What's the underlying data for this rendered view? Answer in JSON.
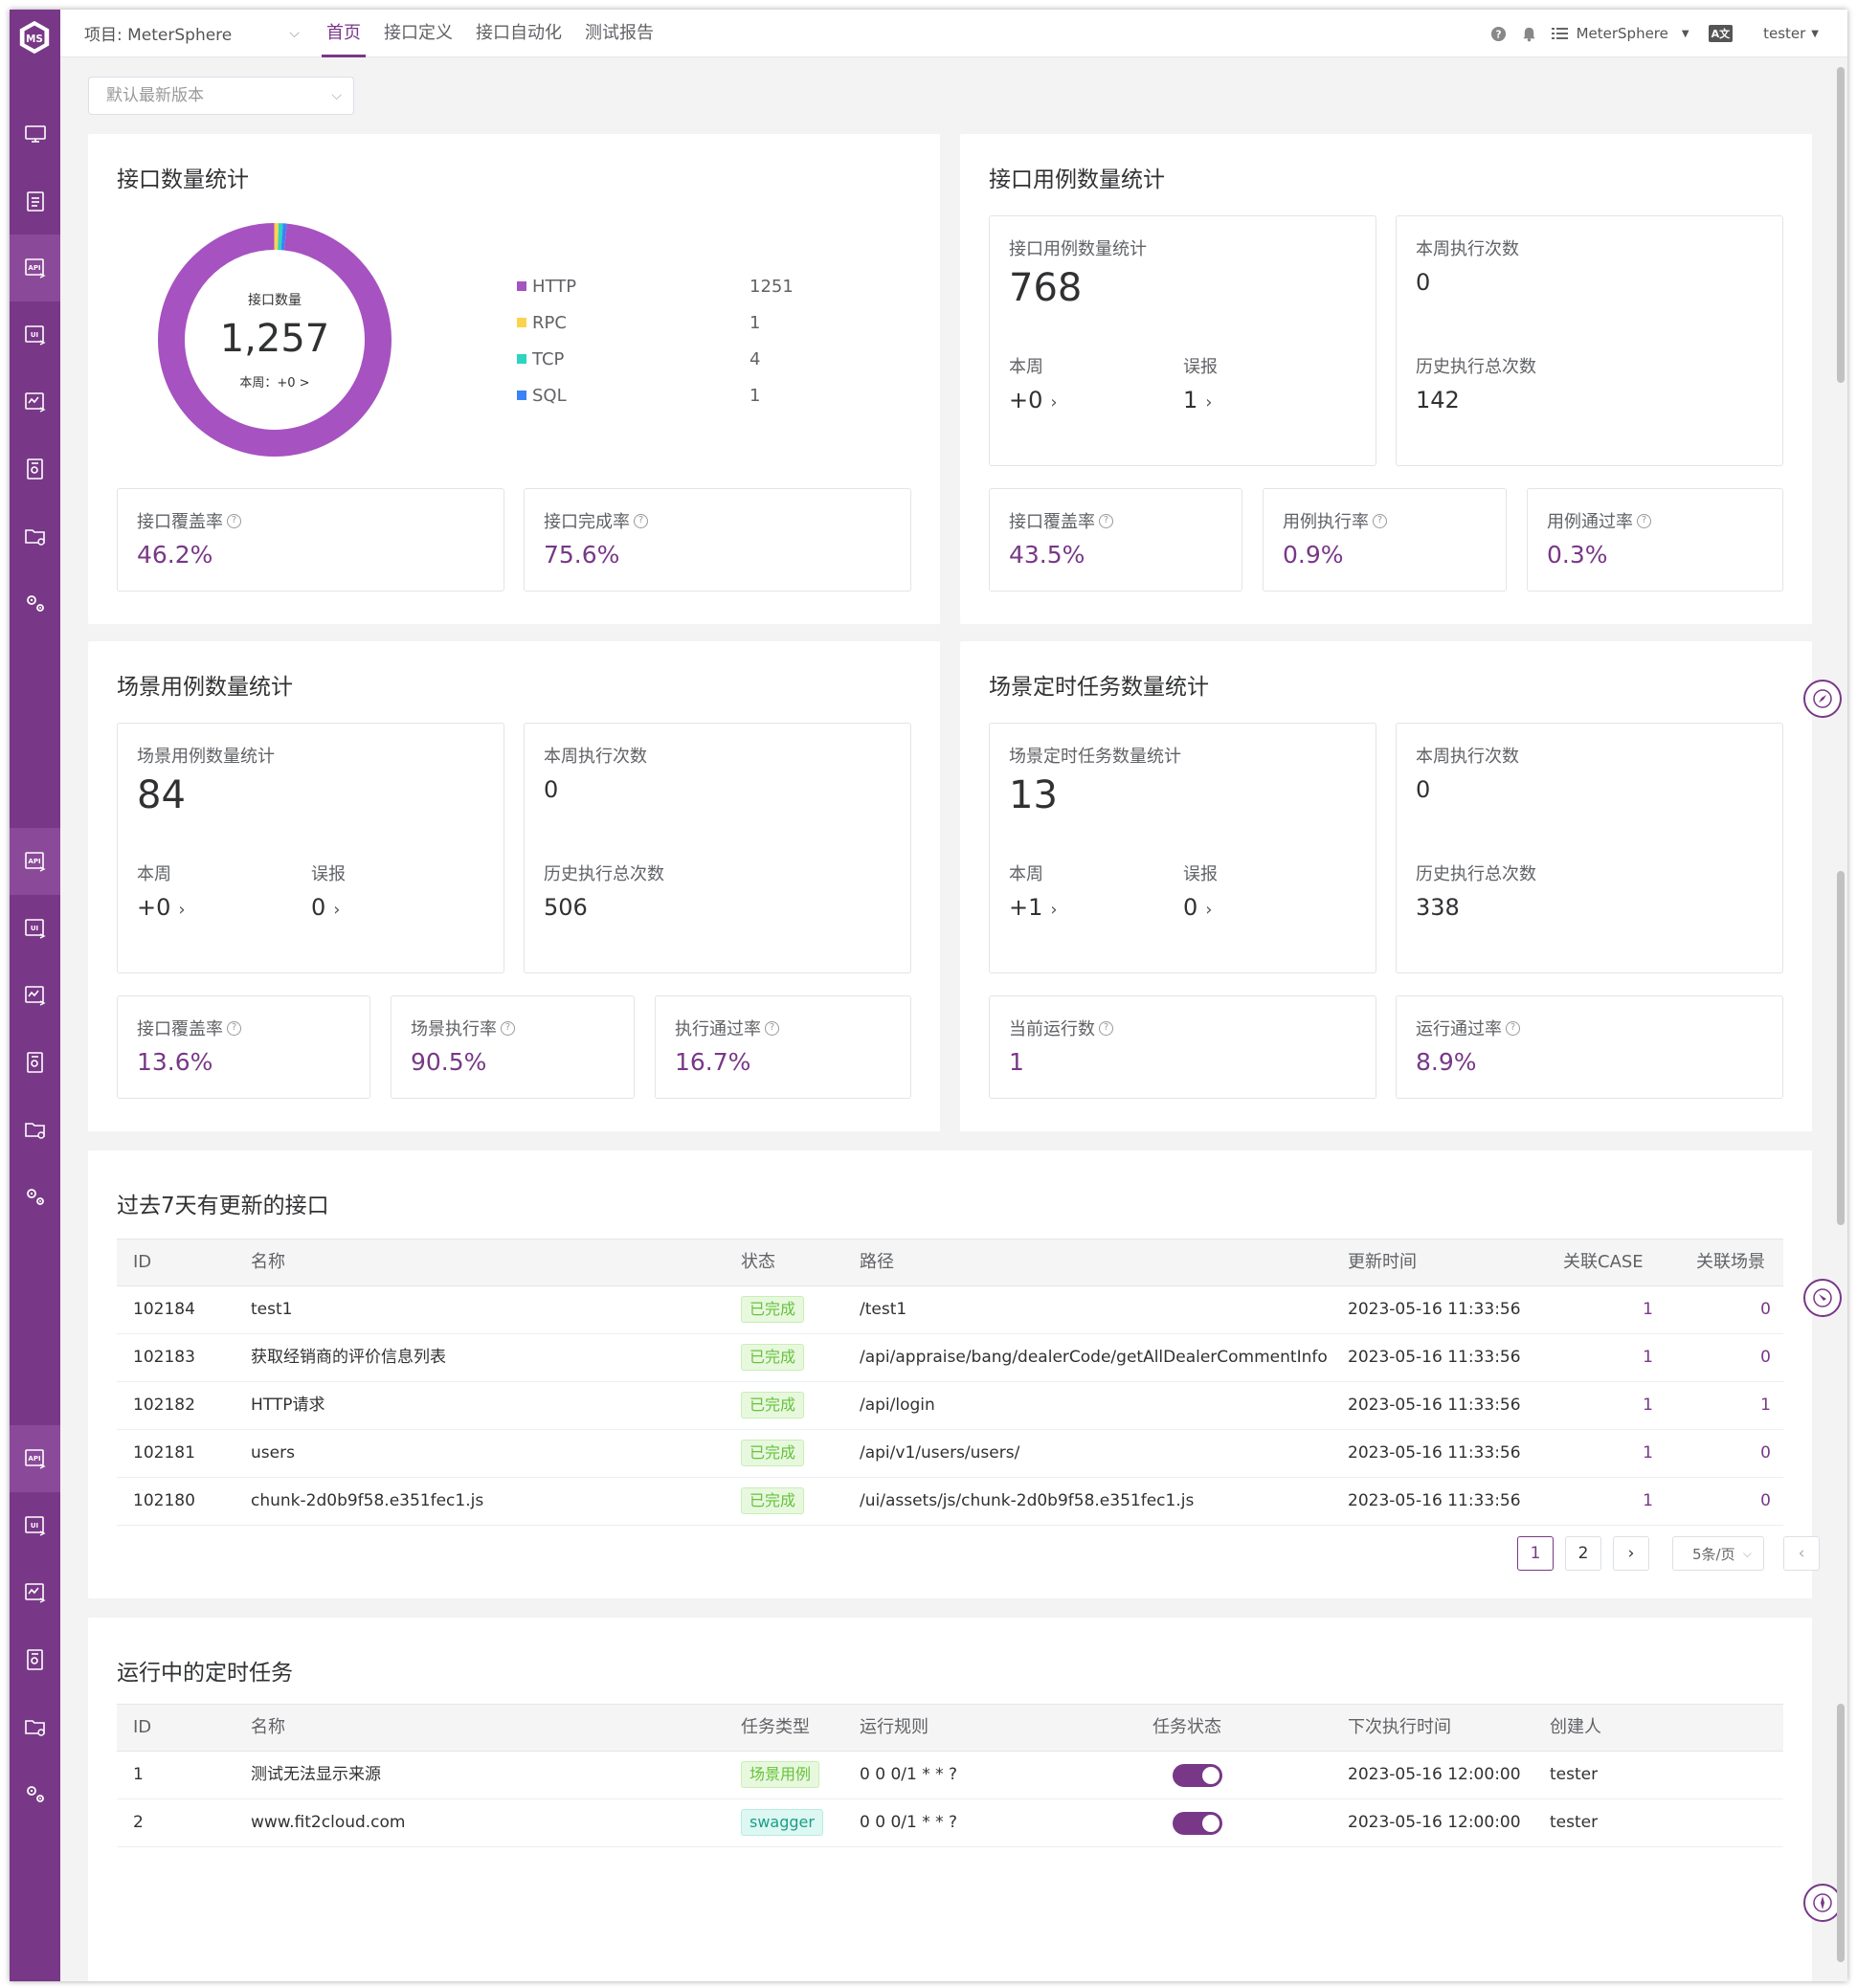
{
  "header": {
    "project_label": "项目: MeterSphere",
    "nav": [
      "首页",
      "接口定义",
      "接口自动化",
      "测试报告"
    ],
    "workspace": "MeterSphere",
    "lang_icon": "A文",
    "user": "tester"
  },
  "version_select": "默认最新版本",
  "api_count": {
    "title": "接口数量统计",
    "donut_label": "接口数量",
    "total": "1,257",
    "week": "本周：+0 >",
    "legend": [
      {
        "name": "HTTP",
        "value": "1251",
        "color": "#a652c1"
      },
      {
        "name": "RPC",
        "value": "1",
        "color": "#fcd34d"
      },
      {
        "name": "TCP",
        "value": "4",
        "color": "#2dd4bf"
      },
      {
        "name": "SQL",
        "value": "1",
        "color": "#3b82f6"
      }
    ],
    "chart_data": {
      "type": "pie",
      "categories": [
        "HTTP",
        "RPC",
        "TCP",
        "SQL"
      ],
      "values": [
        1251,
        1,
        4,
        1
      ]
    },
    "coverage_label": "接口覆盖率",
    "coverage": "46.2%",
    "completion_label": "接口完成率",
    "completion": "75.6%"
  },
  "case_count": {
    "title": "接口用例数量统计",
    "stat_label": "接口用例数量统计",
    "total": "768",
    "week_label": "本周",
    "week": "+0",
    "false_label": "误报",
    "false": "1",
    "exec_week_label": "本周执行次数",
    "exec_week": "0",
    "exec_total_label": "历史执行总次数",
    "exec_total": "142",
    "coverage_label": "接口覆盖率",
    "coverage": "43.5%",
    "exec_rate_label": "用例执行率",
    "exec_rate": "0.9%",
    "pass_rate_label": "用例通过率",
    "pass_rate": "0.3%"
  },
  "scenario_count": {
    "title": "场景用例数量统计",
    "stat_label": "场景用例数量统计",
    "total": "84",
    "week_label": "本周",
    "week": "+0",
    "false_label": "误报",
    "false": "0",
    "exec_week_label": "本周执行次数",
    "exec_week": "0",
    "exec_total_label": "历史执行总次数",
    "exec_total": "506",
    "coverage_label": "接口覆盖率",
    "coverage": "13.6%",
    "exec_rate_label": "场景执行率",
    "exec_rate": "90.5%",
    "pass_rate_label": "执行通过率",
    "pass_rate": "16.7%"
  },
  "schedule_count": {
    "title": "场景定时任务数量统计",
    "stat_label": "场景定时任务数量统计",
    "total": "13",
    "week_label": "本周",
    "week": "+1",
    "false_label": "误报",
    "false": "0",
    "exec_week_label": "本周执行次数",
    "exec_week": "0",
    "exec_total_label": "历史执行总次数",
    "exec_total": "338",
    "running_label": "当前运行数",
    "running": "1",
    "pass_rate_label": "运行通过率",
    "pass_rate": "8.9%"
  },
  "updated_apis": {
    "title": "过去7天有更新的接口",
    "columns": [
      "ID",
      "名称",
      "状态",
      "路径",
      "更新时间",
      "关联CASE",
      "关联场景"
    ],
    "rows": [
      {
        "id": "102184",
        "name": "test1",
        "status": "已完成",
        "path": "/test1",
        "time": "2023-05-16 11:33:56",
        "cases": "1",
        "scenarios": "0"
      },
      {
        "id": "102183",
        "name": "获取经销商的评价信息列表",
        "status": "已完成",
        "path": "/api/appraise/bang/dealerCode/getAllDealerCommentInfo",
        "time": "2023-05-16 11:33:56",
        "cases": "1",
        "scenarios": "0"
      },
      {
        "id": "102182",
        "name": "HTTP请求",
        "status": "已完成",
        "path": "/api/login",
        "time": "2023-05-16 11:33:56",
        "cases": "1",
        "scenarios": "1"
      },
      {
        "id": "102181",
        "name": "users",
        "status": "已完成",
        "path": "/api/v1/users/users/",
        "time": "2023-05-16 11:33:56",
        "cases": "1",
        "scenarios": "0"
      },
      {
        "id": "102180",
        "name": "chunk-2d0b9f58.e351fec1.js",
        "status": "已完成",
        "path": "/ui/assets/js/chunk-2d0b9f58.e351fec1.js",
        "time": "2023-05-16 11:33:56",
        "cases": "1",
        "scenarios": "0"
      }
    ],
    "pager": {
      "prev": "‹",
      "pages": [
        "1",
        "2"
      ],
      "next": "›",
      "size": "5条/页"
    }
  },
  "running_tasks": {
    "title": "运行中的定时任务",
    "columns": [
      "ID",
      "名称",
      "任务类型",
      "运行规则",
      "任务状态",
      "下次执行时间",
      "创建人"
    ],
    "rows": [
      {
        "id": "1",
        "name": "测试无法显示来源",
        "type": "场景用例",
        "rule": "0 0 0/1 * * ?",
        "enabled": true,
        "next": "2023-05-16 12:00:00",
        "creator": "tester"
      },
      {
        "id": "2",
        "name": "www.fit2cloud.com",
        "type": "swagger",
        "rule": "0 0 0/1 * * ?",
        "enabled": true,
        "next": "2023-05-16 12:00:00",
        "creator": "tester"
      }
    ]
  },
  "colors": {
    "brand": "#783887",
    "success": "#67c23a"
  }
}
